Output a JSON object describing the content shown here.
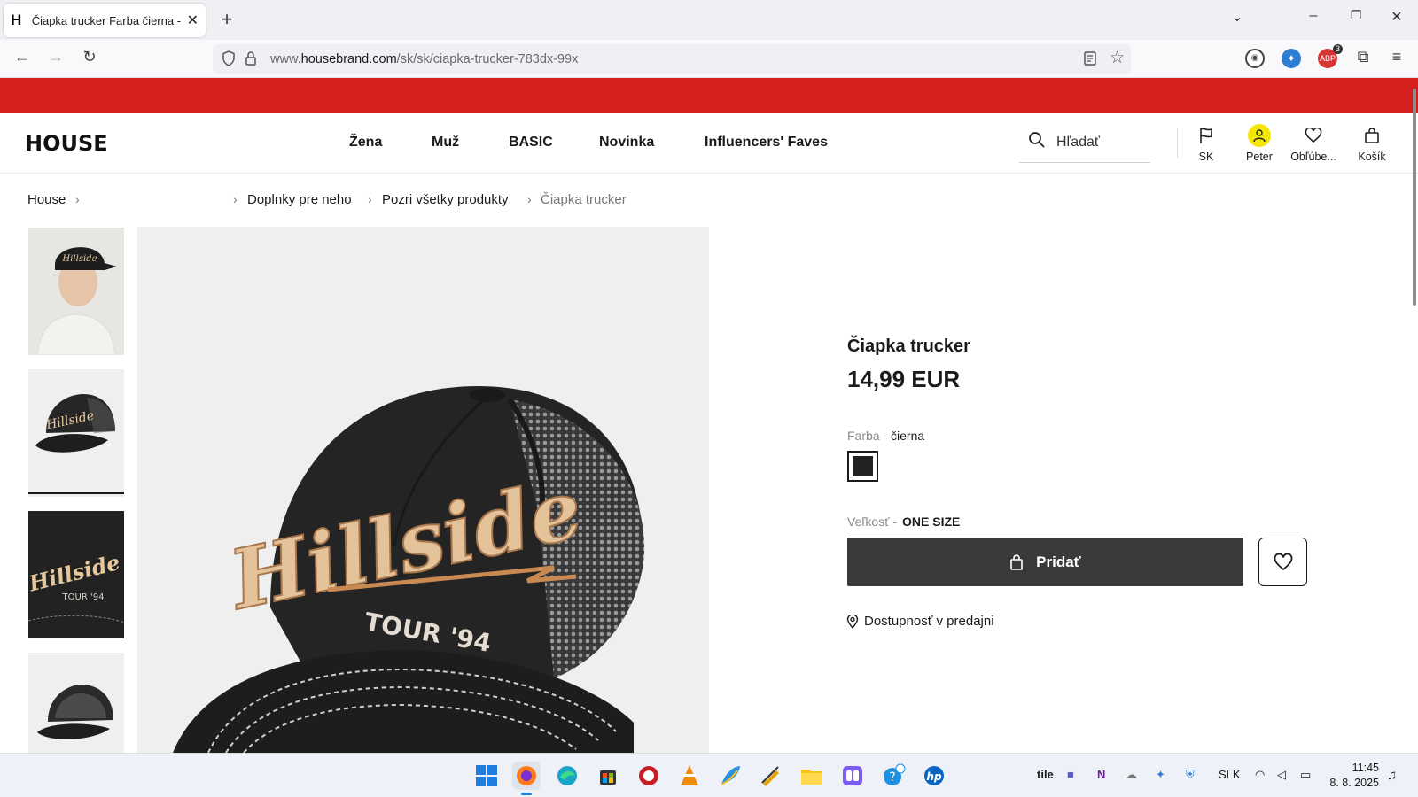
{
  "browser": {
    "tab_title": "Čiapka trucker Farba čierna - HOUSE",
    "tab_favicon": "H",
    "url_prefix": "www.",
    "url_domain": "housebrand.com",
    "url_path": "/sk/sk/ciapka-trucker-783dx-99x",
    "extension_badge": "3"
  },
  "header": {
    "logo": "HOUSE",
    "menu": [
      "Žena",
      "Muž",
      "BASIC",
      "Novinka",
      "Influencers' Faves"
    ],
    "search_placeholder": "Hľadať",
    "actions": {
      "region": "SK",
      "account": "Peter",
      "favorites": "Obľúbe...",
      "cart": "Košík"
    }
  },
  "breadcrumb": {
    "home": "House",
    "items": [
      "Doplnky pre neho",
      "Pozri všetky produkty",
      "Čiapka trucker"
    ]
  },
  "product": {
    "title": "Čiapka trucker",
    "price": "14,99 EUR",
    "color_label": "Farba -",
    "color_value": "čierna",
    "size_label": "Veľkosť -",
    "size_value": "ONE SIZE",
    "add_button": "Pridať",
    "store_availability": "Dostupnosť v predajni",
    "cap_text": "Hillside",
    "cap_subtext": "TOUR '94",
    "accent_color": "#d71f1f",
    "button_color": "#3a3a3a"
  },
  "taskbar": {
    "tray_text": "tile",
    "language": "SLK",
    "time": "11:45",
    "date": "8. 8. 2025"
  }
}
